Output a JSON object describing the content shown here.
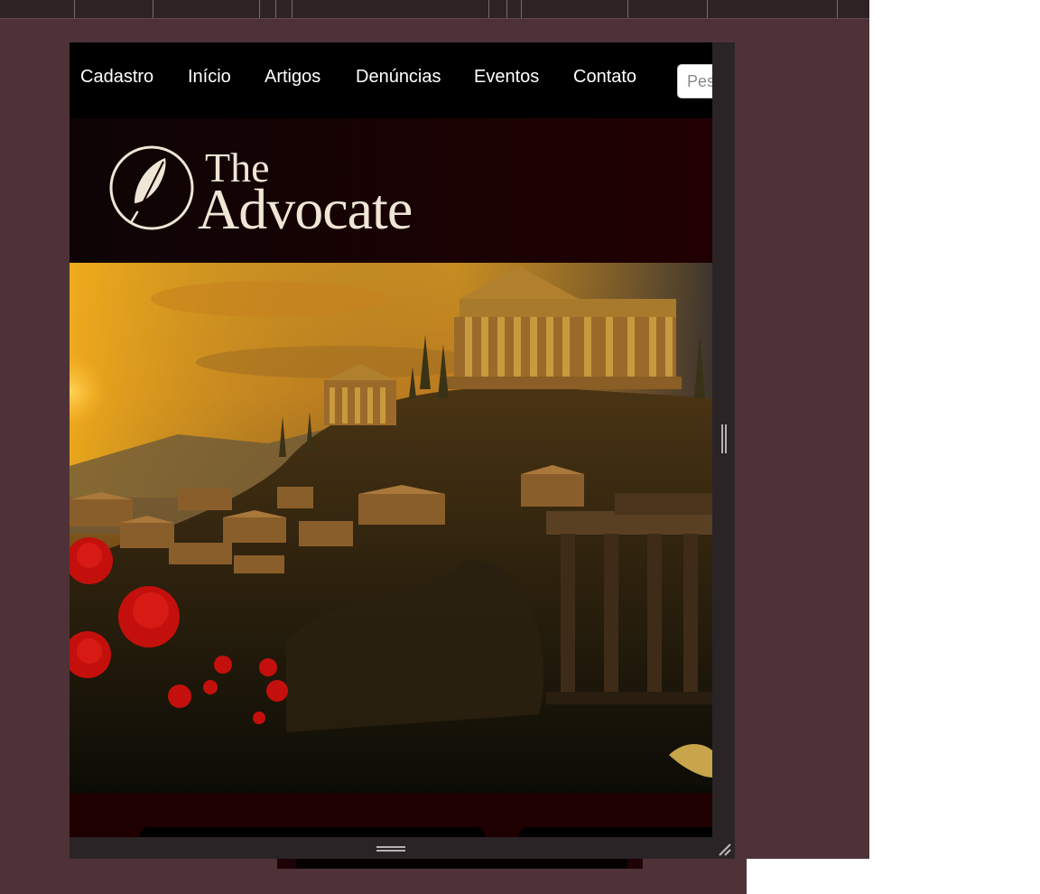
{
  "nav": {
    "items": [
      {
        "label": "Cadastro"
      },
      {
        "label": "Início"
      },
      {
        "label": "Artigos"
      },
      {
        "label": "Denúncias"
      },
      {
        "label": "Eventos"
      },
      {
        "label": "Contato"
      }
    ],
    "search_placeholder": "Pesquisar"
  },
  "brand": {
    "line1": "The",
    "line2": "Advocate",
    "icon": "feather-quill-icon"
  },
  "hero": {
    "alt": "Ancient Greek temples on a hill at sunset with red poppies"
  },
  "colors": {
    "page_background": "#4e3238",
    "navbar": "#000000",
    "header_band": "#1a0203",
    "logo_text": "#efe6d6"
  }
}
